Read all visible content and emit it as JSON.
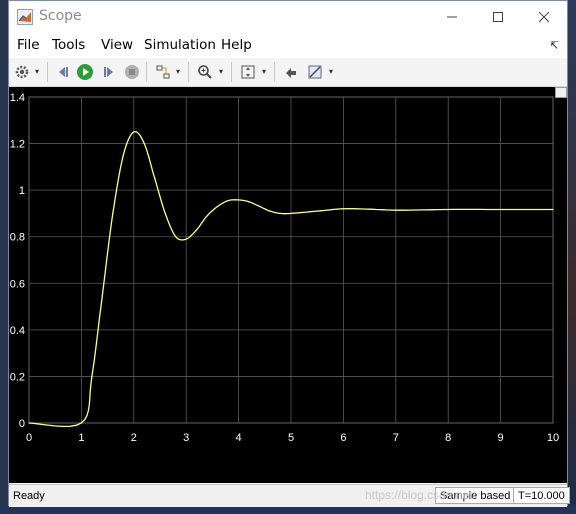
{
  "window": {
    "title": "Scope"
  },
  "menu": {
    "items": [
      "File",
      "Tools",
      "View",
      "Simulation",
      "Help"
    ]
  },
  "toolbar": {
    "icons": [
      "settings-gear-icon",
      "step-back-icon",
      "run-icon",
      "step-forward-icon",
      "stop-icon",
      "highlight-signal-icon",
      "zoom-icon",
      "autoscale-icon",
      "restore-params-icon",
      "triggers-icon"
    ]
  },
  "colors": {
    "plot_bg": "#000000",
    "grid": "#5a5a5a",
    "signal": "#ffff7a",
    "ticks": "#ffffff"
  },
  "chart_data": {
    "type": "line",
    "title": "",
    "xlabel": "",
    "ylabel": "",
    "xlim": [
      0,
      10
    ],
    "ylim": [
      0,
      1.4
    ],
    "xticks": [
      "0",
      "1",
      "2",
      "3",
      "4",
      "5",
      "6",
      "7",
      "8",
      "9",
      "10"
    ],
    "yticks": [
      "0",
      "0.2",
      "0.4",
      "0.6",
      "0.8",
      "1",
      "1.2",
      "1.4"
    ],
    "grid": true,
    "series": [
      {
        "x": [
          0,
          1.0,
          1.2,
          1.4,
          1.6,
          1.8,
          2.0,
          2.2,
          2.4,
          2.6,
          2.8,
          3.0,
          3.2,
          3.4,
          3.6,
          3.8,
          4.0,
          4.2,
          4.4,
          4.6,
          4.8,
          5.0,
          5.5,
          6.0,
          6.5,
          7.0,
          7.5,
          8.0,
          9.0,
          10.0
        ],
        "y": [
          0,
          0,
          0.2,
          0.55,
          0.9,
          1.15,
          1.25,
          1.2,
          1.05,
          0.9,
          0.8,
          0.79,
          0.83,
          0.89,
          0.93,
          0.955,
          0.958,
          0.95,
          0.93,
          0.91,
          0.9,
          0.9,
          0.91,
          0.92,
          0.918,
          0.914,
          0.915,
          0.917,
          0.917,
          0.917
        ]
      }
    ]
  },
  "status": {
    "left": "Ready",
    "mode": "Sample based",
    "time": "T=10.000"
  },
  "watermark": "https://blog.csdn.net/"
}
